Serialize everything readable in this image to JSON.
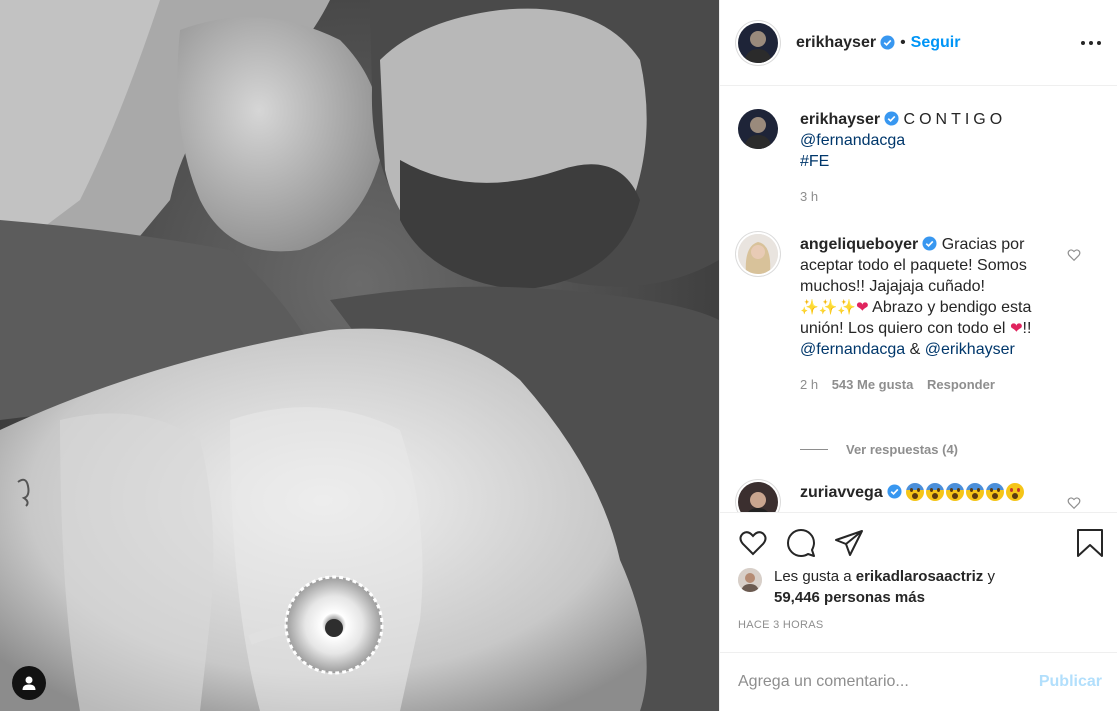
{
  "post": {
    "author": "erikhayser",
    "follow_label": "Seguir",
    "separator": "•",
    "more_icon": "more-options-icon"
  },
  "caption": {
    "username": "erikhayser",
    "text": "CONTIGO",
    "mention": "@fernandacga",
    "hashtag": "#FE",
    "time": "3 h"
  },
  "comments": [
    {
      "username": "angeliqueboyer",
      "text_1": "Gracias por aceptar todo el paquete! Somos muchos!! Jajajaja cuñado!",
      "sparkles": "✨✨✨",
      "heart": "❤",
      "text_2": "Abrazo y bendigo esta unión! Los quiero con todo el",
      "text_3": "!!",
      "mention_1": "@fernandacga",
      "amp": "&",
      "mention_2": "@erikhayser",
      "time": "2 h",
      "likes": "543 Me gusta",
      "reply_label": "Responder",
      "view_replies": "Ver respuestas (4)"
    },
    {
      "username": "zuriavvega"
    }
  ],
  "likes": {
    "prefix": "Les gusta a",
    "user": "erikadlarosaactriz",
    "conj": "y",
    "others": "59,446 personas más"
  },
  "timestamp": "HACE 3 HORAS",
  "composer": {
    "placeholder": "Agrega un comentario...",
    "publish_label": "Publicar"
  },
  "colors": {
    "accent": "#0095f6",
    "publish_disabled": "#b2dffc",
    "verified": "#3897f0",
    "mention": "#00376b"
  }
}
